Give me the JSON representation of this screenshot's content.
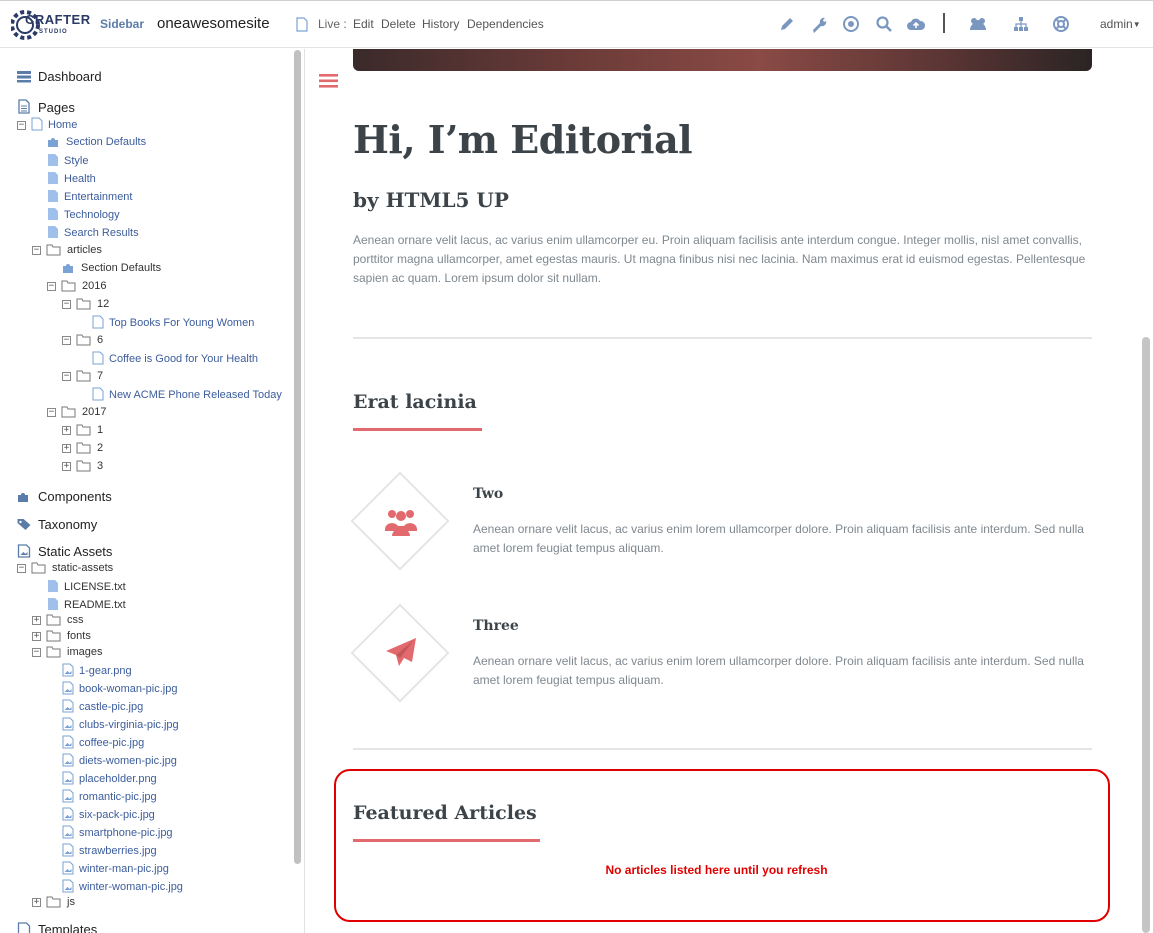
{
  "topbar": {
    "logo_text": "CRAFTER",
    "logo_sub": "STUDIO",
    "sidebar_label": "Sidebar",
    "site_name": "oneawesomesite",
    "live_label": "Live :",
    "actions": {
      "edit": "Edit",
      "delete": "Delete",
      "history": "History",
      "dependencies": "Dependencies"
    },
    "icons": [
      "pencil-icon",
      "wrench-icon",
      "target-icon",
      "search-icon",
      "cloud-upload-icon",
      "users-icon",
      "sitemap-icon",
      "lifebuoy-icon"
    ],
    "user": "admin"
  },
  "sidebar": {
    "dashboard": "Dashboard",
    "pages": "Pages",
    "home": "Home",
    "home_children": [
      "Section Defaults",
      "Style",
      "Health",
      "Entertainment",
      "Technology",
      "Search Results"
    ],
    "articles": "articles",
    "articles_section_defaults": "Section Defaults",
    "year_2016": "2016",
    "month_12": "12",
    "article_12": "Top Books For Young Women",
    "month_6": "6",
    "article_6": "Coffee is Good for Your Health",
    "month_7": "7",
    "article_7": "New ACME Phone Released Today",
    "year_2017": "2017",
    "months_2017": [
      "1",
      "2",
      "3"
    ],
    "components": "Components",
    "taxonomy": "Taxonomy",
    "static_assets": "Static Assets",
    "static_assets_folder": "static-assets",
    "static_files": [
      "LICENSE.txt",
      "README.txt"
    ],
    "folders": [
      "css",
      "fonts"
    ],
    "images_folder": "images",
    "images": [
      "1-gear.png",
      "book-woman-pic.jpg",
      "castle-pic.jpg",
      "clubs-virginia-pic.jpg",
      "coffee-pic.jpg",
      "diets-women-pic.jpg",
      "placeholder.png",
      "romantic-pic.jpg",
      "six-pack-pic.jpg",
      "smartphone-pic.jpg",
      "strawberries.jpg",
      "winter-man-pic.jpg",
      "winter-woman-pic.jpg"
    ],
    "js_folder": "js",
    "templates": "Templates"
  },
  "main": {
    "title": "Hi, I’m Editorial",
    "subtitle": "by HTML5 UP",
    "intro": "Aenean ornare velit lacus, ac varius enim ullamcorper eu. Proin aliquam facilisis ante interdum congue. Integer mollis, nisl amet convallis, porttitor magna ullamcorper, amet egestas mauris. Ut magna finibus nisi nec lacinia. Nam maximus erat id euismod egestas. Pellentesque sapien ac quam. Lorem ipsum dolor sit nullam.",
    "section_heading": "Erat lacinia",
    "features": [
      {
        "title": "Two",
        "text": "Aenean ornare velit lacus, ac varius enim lorem ullamcorper dolore. Proin aliquam facilisis ante interdum. Sed nulla amet lorem feugiat tempus aliquam."
      },
      {
        "title": "Three",
        "text": "Aenean ornare velit lacus, ac varius enim lorem ullamcorper dolore. Proin aliquam facilisis ante interdum. Sed nulla amet lorem feugiat tempus aliquam."
      }
    ],
    "featured_heading": "Featured Articles",
    "featured_message": "No articles listed here until you refresh"
  },
  "colors": {
    "accent": "#e26a6e",
    "link": "#3c5d9c",
    "alert": "#e00000",
    "icon": "#5a7ca8"
  }
}
